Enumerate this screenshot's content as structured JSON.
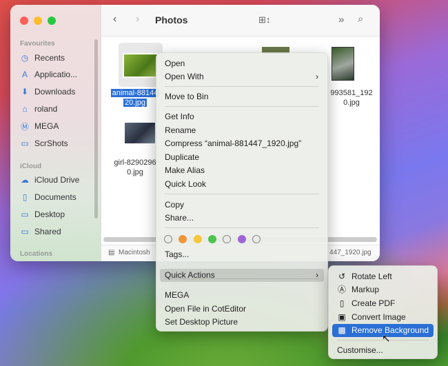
{
  "window": {
    "title": "Photos"
  },
  "sidebar": {
    "favourites_label": "Favourites",
    "favourites": [
      {
        "label": "Recents",
        "icon": "clock-icon"
      },
      {
        "label": "Applicatio...",
        "icon": "applications-icon"
      },
      {
        "label": "Downloads",
        "icon": "download-icon"
      },
      {
        "label": "roland",
        "icon": "home-icon"
      },
      {
        "label": "MEGA",
        "icon": "mega-icon"
      },
      {
        "label": "ScrShots",
        "icon": "folder-icon"
      }
    ],
    "icloud_label": "iCloud",
    "icloud": [
      {
        "label": "iCloud Drive",
        "icon": "cloud-icon"
      },
      {
        "label": "Documents",
        "icon": "document-icon"
      },
      {
        "label": "Desktop",
        "icon": "desktop-icon"
      },
      {
        "label": "Shared",
        "icon": "shared-folder-icon"
      }
    ],
    "locations_label": "Locations"
  },
  "files": [
    {
      "name_line1": "animal-88144",
      "name_line2": "20.jpg",
      "selected": true
    },
    {
      "name_line1": "girl-8290296",
      "name_line2": "0.jpg"
    },
    {
      "name_line1": "993581_192",
      "name_line2": "0.jpg"
    }
  ],
  "pathbar": {
    "left": "Macintosh",
    "right": "447_1920.jpg"
  },
  "context_menu": {
    "items": [
      "Open",
      "Open With",
      "Move to Bin",
      "Get Info",
      "Rename",
      "Compress “animal-881447_1920.jpg”",
      "Duplicate",
      "Make Alias",
      "Quick Look",
      "Copy",
      "Share...",
      "Tags...",
      "Quick Actions",
      "MEGA",
      "Open File in CotEditor",
      "Set Desktop Picture"
    ],
    "tag_colors": [
      "none",
      "#f0973a",
      "#f5c73a",
      "#4fc24f",
      "none",
      "#a064d6",
      "none"
    ],
    "highlighted": "Quick Actions"
  },
  "quick_actions": {
    "items": [
      {
        "label": "Rotate Left",
        "icon": "rotate-left-icon"
      },
      {
        "label": "Markup",
        "icon": "markup-icon"
      },
      {
        "label": "Create PDF",
        "icon": "document-icon"
      },
      {
        "label": "Convert Image",
        "icon": "convert-image-icon"
      },
      {
        "label": "Remove Background",
        "icon": "remove-background-icon"
      }
    ],
    "customise": "Customise...",
    "selected": "Remove Background",
    "accent": "#2a6fd6"
  }
}
